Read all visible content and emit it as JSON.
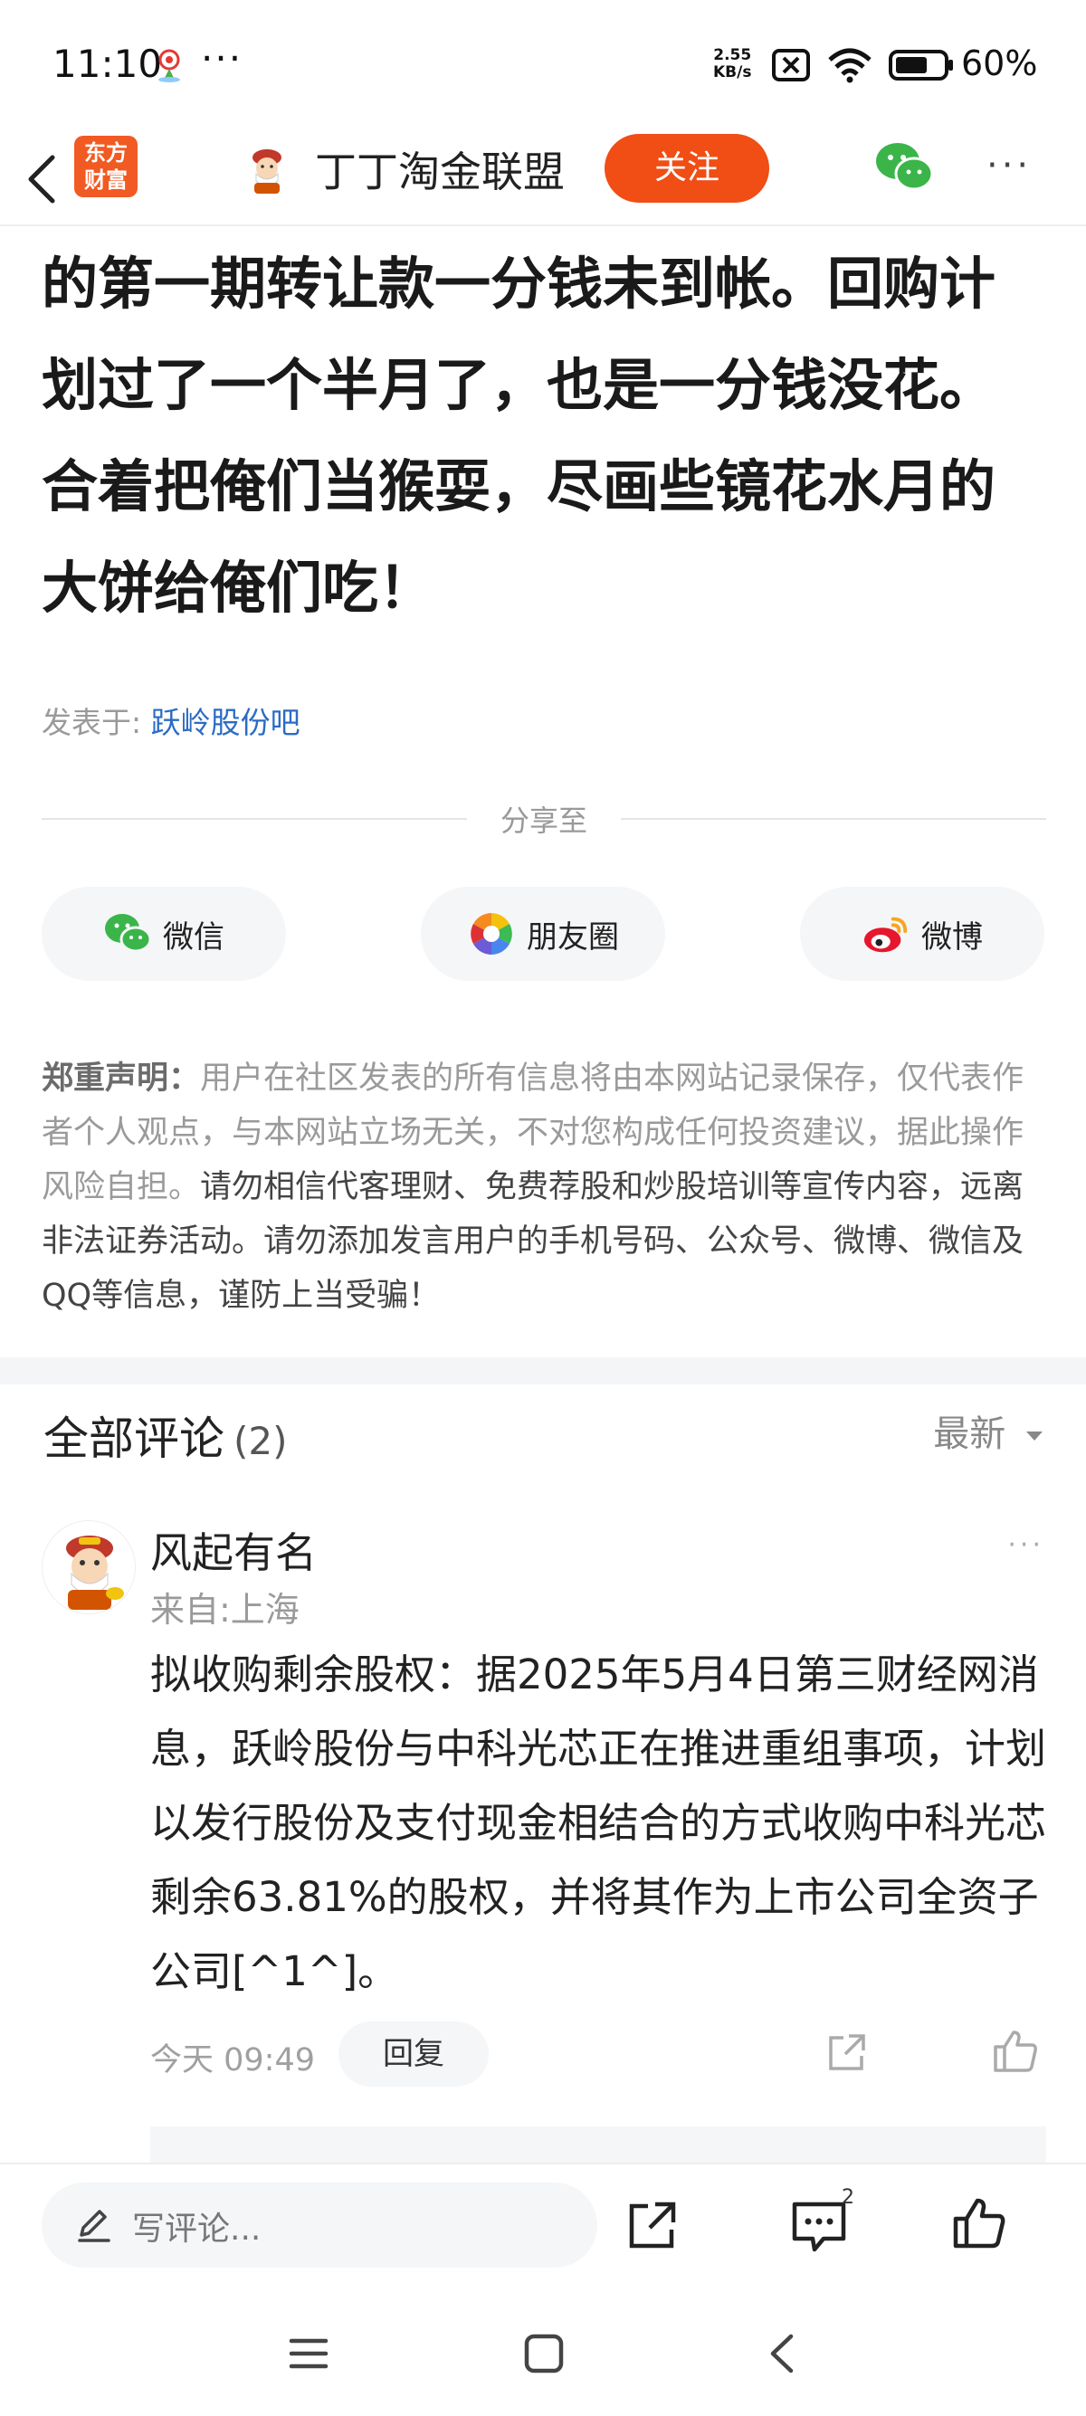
{
  "status_bar": {
    "time": "11:10",
    "more": "···",
    "net_speed_value": "2.55",
    "net_speed_unit": "KB/s",
    "battery": "60%"
  },
  "nav": {
    "logo_line1": "东方",
    "logo_line2": "财富",
    "title": "丁丁淘金联盟",
    "follow": "关注",
    "more": "···"
  },
  "article": {
    "body": "的第一期转让款一分钱未到帐。回购计划过了一个半月了，也是一分钱没花。合着把俺们当猴耍，尽画些镜花水月的大饼给俺们吃！",
    "posted_label": "发表于:",
    "posted_forum": "跃岭股份吧"
  },
  "share": {
    "heading": "分享至",
    "wechat": "微信",
    "moments": "朋友圈",
    "weibo": "微博"
  },
  "disclaimer": {
    "label": "郑重声明：",
    "part1": "用户在社区发表的所有信息将由本网站记录保存，仅代表作者个人观点，与本网站立场无关，不对您构成任何投资建议，据此操作风险自担。",
    "part2": "请勿相信代客理财、免费荐股和炒股培训等宣传内容，远离非法证券活动。请勿添加发言用户的手机号码、公众号、微博、微信及QQ等信息，谨防上当受骗！"
  },
  "comments": {
    "title": "全部评论",
    "count": "(2)",
    "sort": "最新",
    "items": [
      {
        "name": "风起有名",
        "location": "来自:上海",
        "more": "···",
        "text": "拟收购剩余股权：据2025年5月4日第三财经网消息，跃岭股份与中科光芯正在推进重组事项，计划以发行股份及支付现金相结合的方式收购中科光芯剩余63.81%的股权，并将其作为上市公司全资子公司[^1^]。",
        "time": "今天 09:49",
        "reply": "回复"
      }
    ]
  },
  "bottom_bar": {
    "write_placeholder": "写评论...",
    "comment_badge": "2"
  },
  "colors": {
    "brand_orange": "#f04e15",
    "link_blue": "#2b6cc4",
    "wechat_green": "#3bb54a"
  }
}
